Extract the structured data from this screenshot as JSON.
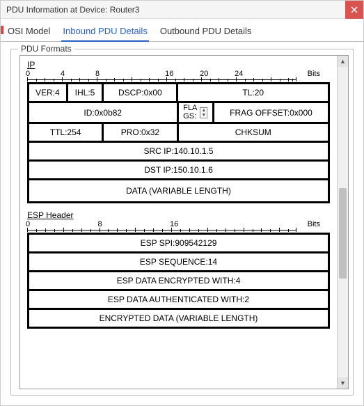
{
  "window": {
    "title": "PDU Information at Device: Router3"
  },
  "tabs": {
    "osi": "OSI Model",
    "inbound": "Inbound PDU Details",
    "outbound": "Outbound PDU Details"
  },
  "fieldset_label": "PDU Formats",
  "ip": {
    "section_title": "IP",
    "ruler": {
      "ticks": [
        "0",
        "4",
        "8",
        "16",
        "20",
        "24"
      ],
      "bits_label": "Bits"
    },
    "ver": "VER:4",
    "ihl": "IHL:5",
    "dscp": "DSCP:0x00",
    "tl": "TL:20",
    "id": "ID:0x0b82",
    "flags_label": "FLAGS:",
    "frag": "FRAG OFFSET:0x000",
    "ttl": "TTL:254",
    "pro": "PRO:0x32",
    "chksum": "CHKSUM",
    "src": "SRC IP:140.10.1.5",
    "dst": "DST IP:150.10.1.6",
    "data": "DATA (VARIABLE LENGTH)"
  },
  "esp": {
    "section_title": "ESP Header",
    "ruler": {
      "ticks": [
        "0",
        "8",
        "16"
      ],
      "bits_label": "Bits"
    },
    "spi": "ESP SPI:909542129",
    "seq": "ESP SEQUENCE:14",
    "enc_with": "ESP DATA ENCRYPTED WITH:4",
    "auth_with": "ESP DATA AUTHENTICATED WITH:2",
    "enc_data": "ENCRYPTED DATA (VARIABLE LENGTH)"
  }
}
